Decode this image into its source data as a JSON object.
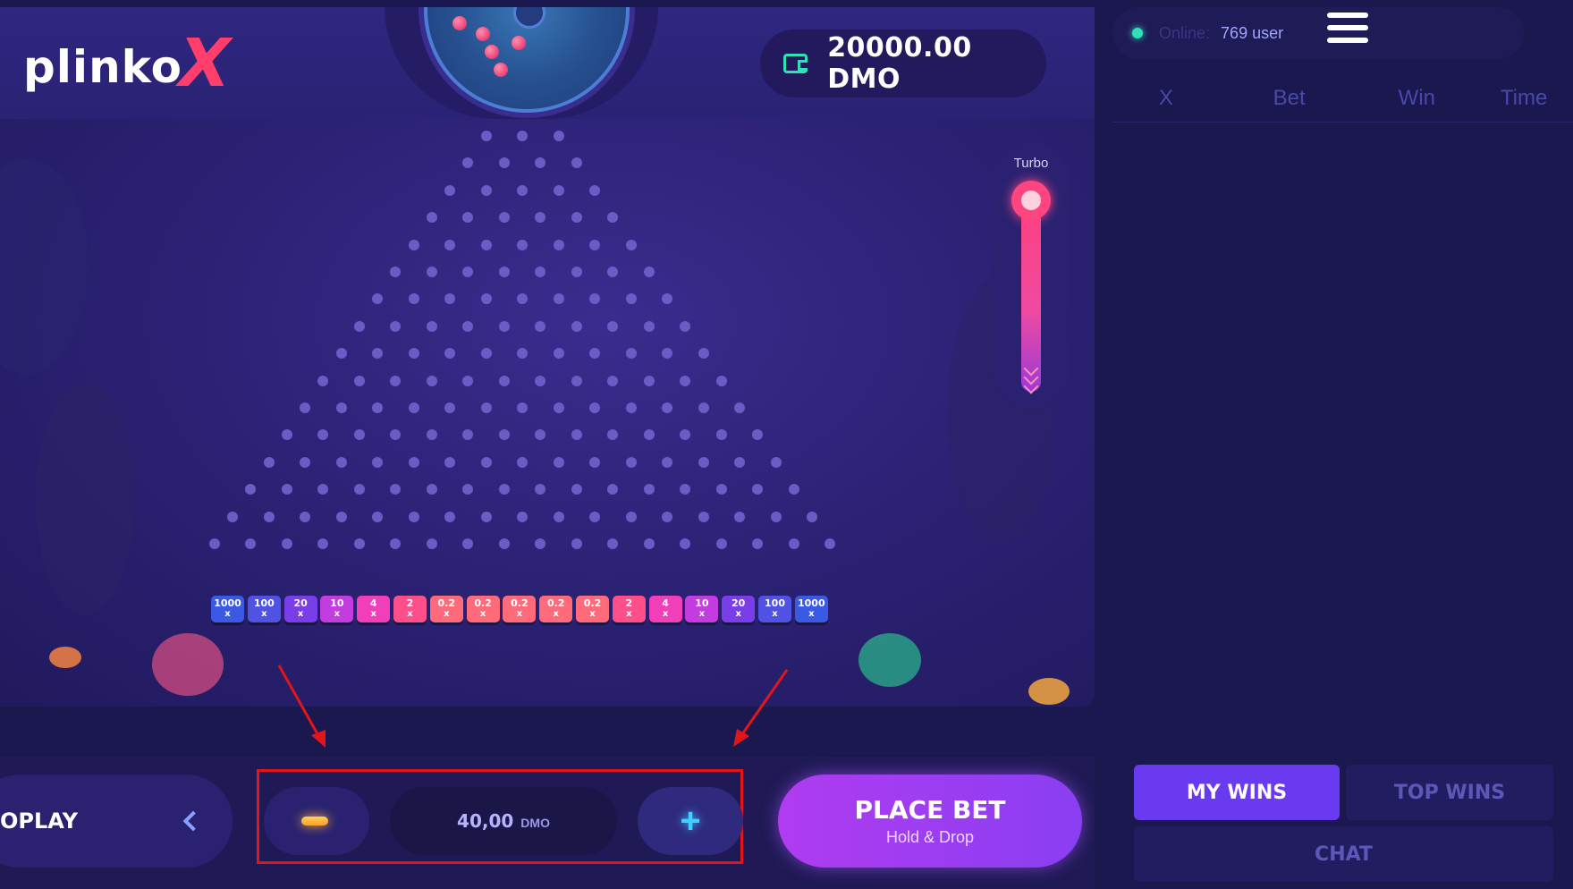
{
  "logo": {
    "text": "plinko",
    "accent": "X"
  },
  "balance": {
    "icon": "wallet-icon",
    "amount": "20000.00 DMO"
  },
  "turbo": {
    "label": "Turbo"
  },
  "multipliers": [
    {
      "v": "1000",
      "m": "x",
      "color": "#3a5ae6"
    },
    {
      "v": "100",
      "m": "x",
      "color": "#5052e4"
    },
    {
      "v": "20",
      "m": "x",
      "color": "#7a3ee8"
    },
    {
      "v": "10",
      "m": "x",
      "color": "#c23ce0"
    },
    {
      "v": "4",
      "m": "x",
      "color": "#f03fb8"
    },
    {
      "v": "2",
      "m": "x",
      "color": "#ff4f8a"
    },
    {
      "v": "0.2",
      "m": "x",
      "color": "#ff6b7a"
    },
    {
      "v": "0.2",
      "m": "x",
      "color": "#ff6b7a"
    },
    {
      "v": "0.2",
      "m": "x",
      "color": "#ff6b7a"
    },
    {
      "v": "0.2",
      "m": "x",
      "color": "#ff6b7a"
    },
    {
      "v": "0.2",
      "m": "x",
      "color": "#ff6b7a"
    },
    {
      "v": "2",
      "m": "x",
      "color": "#ff4f8a"
    },
    {
      "v": "4",
      "m": "x",
      "color": "#f03fb8"
    },
    {
      "v": "10",
      "m": "x",
      "color": "#c23ce0"
    },
    {
      "v": "20",
      "m": "x",
      "color": "#7a3ee8"
    },
    {
      "v": "100",
      "m": "x",
      "color": "#5052e4"
    },
    {
      "v": "1000",
      "m": "x",
      "color": "#3a5ae6"
    }
  ],
  "controls": {
    "autoplay_label": "OPLAY",
    "bet_amount": "40,00",
    "bet_currency": "DMO",
    "place_bet_label": "PLACE BET",
    "place_bet_sub": "Hold & Drop"
  },
  "panel": {
    "online_label": "Online:",
    "online_count": "769 user",
    "columns": [
      "X",
      "Bet",
      "Win",
      "Time"
    ],
    "tabs": {
      "my_wins": "MY WINS",
      "top_wins": "TOP WINS",
      "chat": "CHAT"
    }
  },
  "colors": {
    "accent": "#6a3af0",
    "place_bet": "#b03cf0",
    "online": "#2fe0b9",
    "highlight_box": "#e0161b"
  }
}
